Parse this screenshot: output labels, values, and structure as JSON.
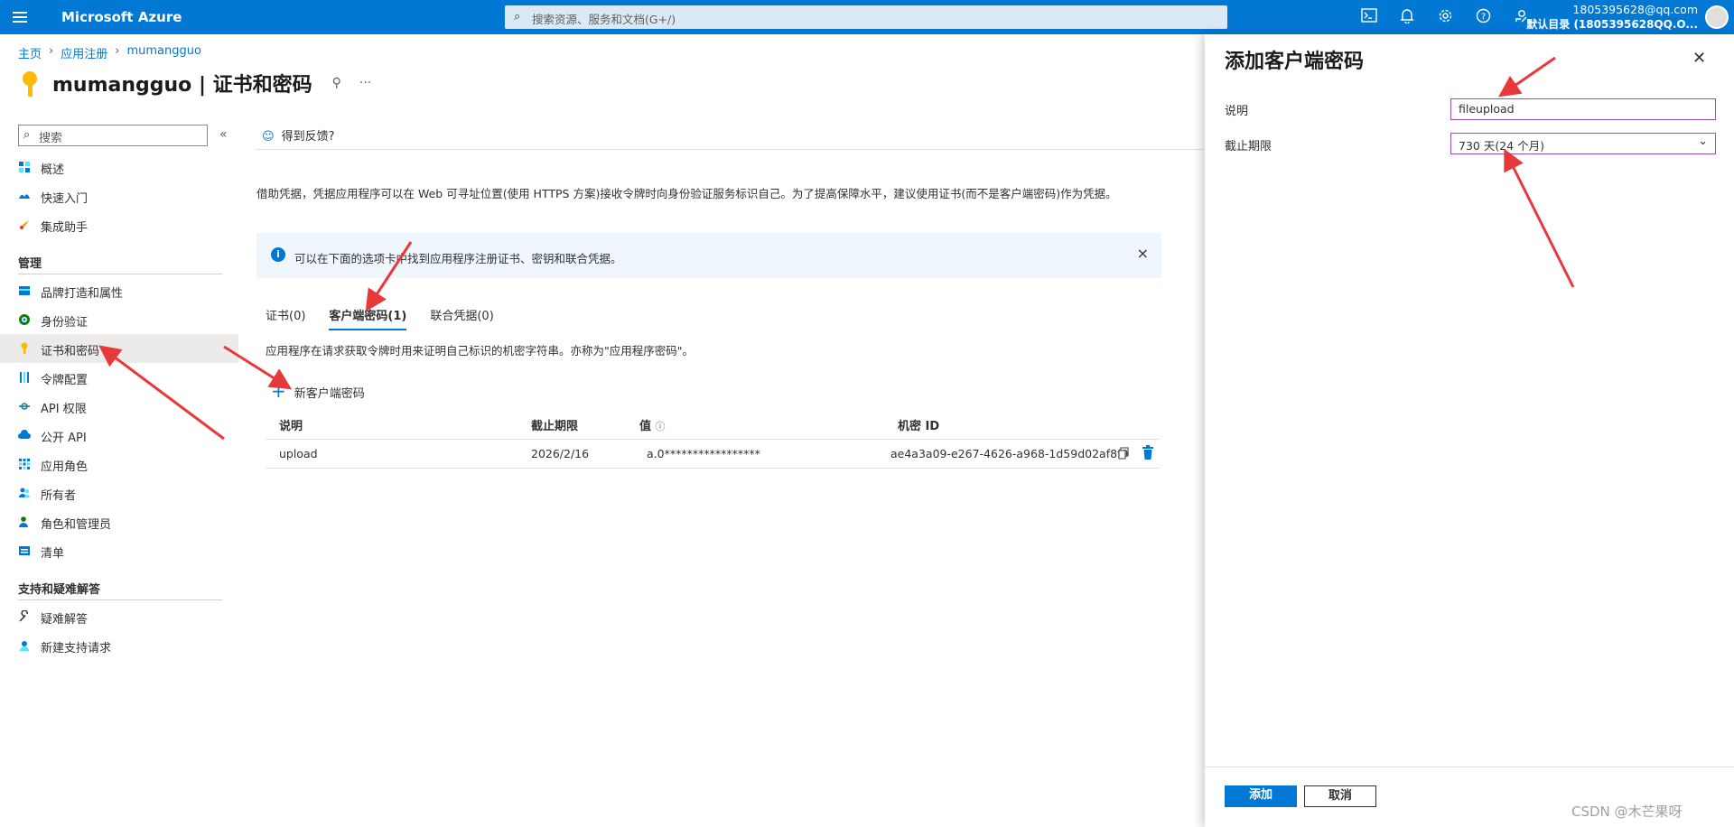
{
  "topbar": {
    "brand": "Microsoft Azure",
    "search_placeholder": "搜索资源、服务和文档(G+/)",
    "user_email": "1805395628@qq.com",
    "user_directory": "默认目录 (1805395628QQ.O...",
    "icons": [
      "cloud-shell-icon",
      "bell-icon",
      "gear-icon",
      "help-icon",
      "feedback-icon"
    ]
  },
  "breadcrumb": [
    "主页",
    "应用注册",
    "mumangguo"
  ],
  "page": {
    "title": "mumangguo | 证书和密码",
    "pin_glyph": "⚲",
    "more_glyph": "···"
  },
  "sidebar": {
    "search_placeholder": "搜索",
    "collapse_glyph": "«",
    "top_items": [
      {
        "label": "概述",
        "icon": "overview-icon"
      },
      {
        "label": "快速入门",
        "icon": "quickstart-icon"
      },
      {
        "label": "集成助手",
        "icon": "rocket-icon"
      }
    ],
    "manage_title": "管理",
    "manage_items": [
      {
        "label": "品牌打造和属性",
        "icon": "branding-icon"
      },
      {
        "label": "身份验证",
        "icon": "auth-icon"
      },
      {
        "label": "证书和密码",
        "icon": "key-icon"
      },
      {
        "label": "令牌配置",
        "icon": "token-icon"
      },
      {
        "label": "API 权限",
        "icon": "api-permission-icon"
      },
      {
        "label": "公开 API",
        "icon": "cloud-icon"
      },
      {
        "label": "应用角色",
        "icon": "app-roles-icon"
      },
      {
        "label": "所有者",
        "icon": "owners-icon"
      },
      {
        "label": "角色和管理员",
        "icon": "roles-admin-icon"
      },
      {
        "label": "清单",
        "icon": "manifest-icon"
      }
    ],
    "support_title": "支持和疑难解答",
    "support_items": [
      {
        "label": "疑难解答",
        "icon": "wrench-icon"
      },
      {
        "label": "新建支持请求",
        "icon": "support-icon"
      }
    ]
  },
  "content": {
    "feedback": "得到反馈?",
    "description": "借助凭据，凭据应用程序可以在 Web 可寻址位置(使用 HTTPS 方案)接收令牌时向身份验证服务标识自己。为了提高保障水平，建议使用证书(而不是客户端密码)作为凭据。",
    "info": "可以在下面的选项卡中找到应用程序注册证书、密钥和联合凭据。",
    "info_icon": "i",
    "info_close": "×",
    "tabs": [
      "证书(0)",
      "客户端密码(1)",
      "联合凭据(0)"
    ],
    "tab_description": "应用程序在请求获取令牌时用来证明自己标识的机密字符串。亦称为\"应用程序密码\"。",
    "new_secret": "新客户端密码",
    "new_secret_plus": "+",
    "table": {
      "headers": [
        "说明",
        "截止期限",
        "值",
        "机密 ID"
      ],
      "value_info_glyph": "ⓘ",
      "rows": [
        {
          "description": "upload",
          "expires": "2026/2/16",
          "value": "a.0*****************",
          "secret_id": "ae4a3a09-e267-4626-a968-1d59d02af8f9"
        }
      ]
    }
  },
  "panel": {
    "title": "添加客户端密码",
    "close_glyph": "✕",
    "description_label": "说明",
    "description_value": "fileupload",
    "expires_label": "截止期限",
    "expires_value": "730 天(24 个月)",
    "chevron_glyph": "⌄",
    "add_button": "添加",
    "cancel_button": "取消"
  },
  "watermark": "CSDN @木芒果呀",
  "colors": {
    "accent": "#0078d4",
    "annotation_arrow": "#e8393a",
    "input_border": "#a24ac2"
  }
}
